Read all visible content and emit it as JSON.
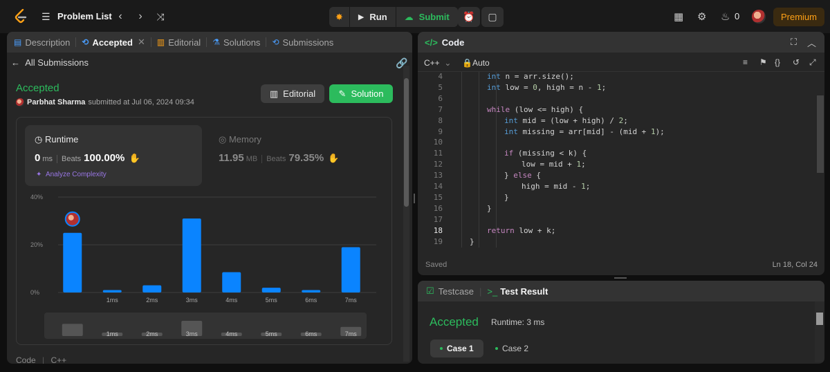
{
  "topbar": {
    "problem_list": "Problem List",
    "run_label": "Run",
    "submit_label": "Submit",
    "streak_count": "0",
    "premium_label": "Premium"
  },
  "left": {
    "tabs": [
      {
        "label": "Description",
        "icon": "doc-icon"
      },
      {
        "label": "Accepted",
        "icon": "clock-icon"
      },
      {
        "label": "Editorial",
        "icon": "book-icon"
      },
      {
        "label": "Solutions",
        "icon": "flask-icon"
      },
      {
        "label": "Submissions",
        "icon": "history-icon"
      }
    ],
    "all_submissions": "All Submissions",
    "status": "Accepted",
    "author": "Parbhat Sharma",
    "submitted_at": "submitted at Jul 06, 2024 09:34",
    "editorial_button": "Editorial",
    "solution_button": "Solution",
    "runtime": {
      "title": "Runtime",
      "value": "0",
      "unit": "ms",
      "beats_label": "Beats",
      "beats_value": "100.00%",
      "analyze": "Analyze Complexity"
    },
    "memory": {
      "title": "Memory",
      "value": "11.95",
      "unit": "MB",
      "beats_label": "Beats",
      "beats_value": "79.35%"
    },
    "bottom_tabs": [
      "Code",
      "C++"
    ]
  },
  "chart_data": {
    "type": "bar",
    "categories": [
      "0ms",
      "1ms",
      "2ms",
      "3ms",
      "4ms",
      "5ms",
      "6ms",
      "7ms"
    ],
    "tick_labels": [
      "",
      "1ms",
      "2ms",
      "3ms",
      "4ms",
      "5ms",
      "6ms",
      "7ms"
    ],
    "values": [
      25,
      1,
      3,
      31,
      8.5,
      2,
      1,
      19
    ],
    "y_ticks": [
      "40%",
      "20%",
      "0%"
    ],
    "ylim": [
      0,
      40
    ],
    "highlight_color": "#0a84ff"
  },
  "code_panel": {
    "title": "Code",
    "language": "C++",
    "mode": "Auto",
    "status": "Saved",
    "cursor": "Ln 18, Col 24",
    "lines": [
      {
        "n": "4",
        "indent": 2,
        "text": "int n = arr.size();"
      },
      {
        "n": "5",
        "indent": 2,
        "text": "int low = 0, high = n - 1;"
      },
      {
        "n": "6",
        "indent": 0,
        "text": ""
      },
      {
        "n": "7",
        "indent": 2,
        "text": "while (low <= high) {"
      },
      {
        "n": "8",
        "indent": 3,
        "text": "int mid = (low + high) / 2;"
      },
      {
        "n": "9",
        "indent": 3,
        "text": "int missing = arr[mid] - (mid + 1);"
      },
      {
        "n": "10",
        "indent": 0,
        "text": ""
      },
      {
        "n": "11",
        "indent": 3,
        "text": "if (missing < k) {"
      },
      {
        "n": "12",
        "indent": 4,
        "text": "low = mid + 1;"
      },
      {
        "n": "13",
        "indent": 3,
        "text": "} else {"
      },
      {
        "n": "14",
        "indent": 4,
        "text": "high = mid - 1;"
      },
      {
        "n": "15",
        "indent": 3,
        "text": "}"
      },
      {
        "n": "16",
        "indent": 2,
        "text": "}"
      },
      {
        "n": "17",
        "indent": 0,
        "text": ""
      },
      {
        "n": "18",
        "indent": 2,
        "text": "return low + k;"
      },
      {
        "n": "19",
        "indent": 1,
        "text": "}"
      }
    ]
  },
  "test_panel": {
    "testcase_tab": "Testcase",
    "result_tab": "Test Result",
    "status": "Accepted",
    "runtime": "Runtime: 3 ms",
    "cases": [
      "Case 1",
      "Case 2"
    ]
  },
  "colors": {
    "accent_green": "#2cbb5d",
    "premium_orange": "#ffa116",
    "bar_blue": "#0a84ff"
  }
}
